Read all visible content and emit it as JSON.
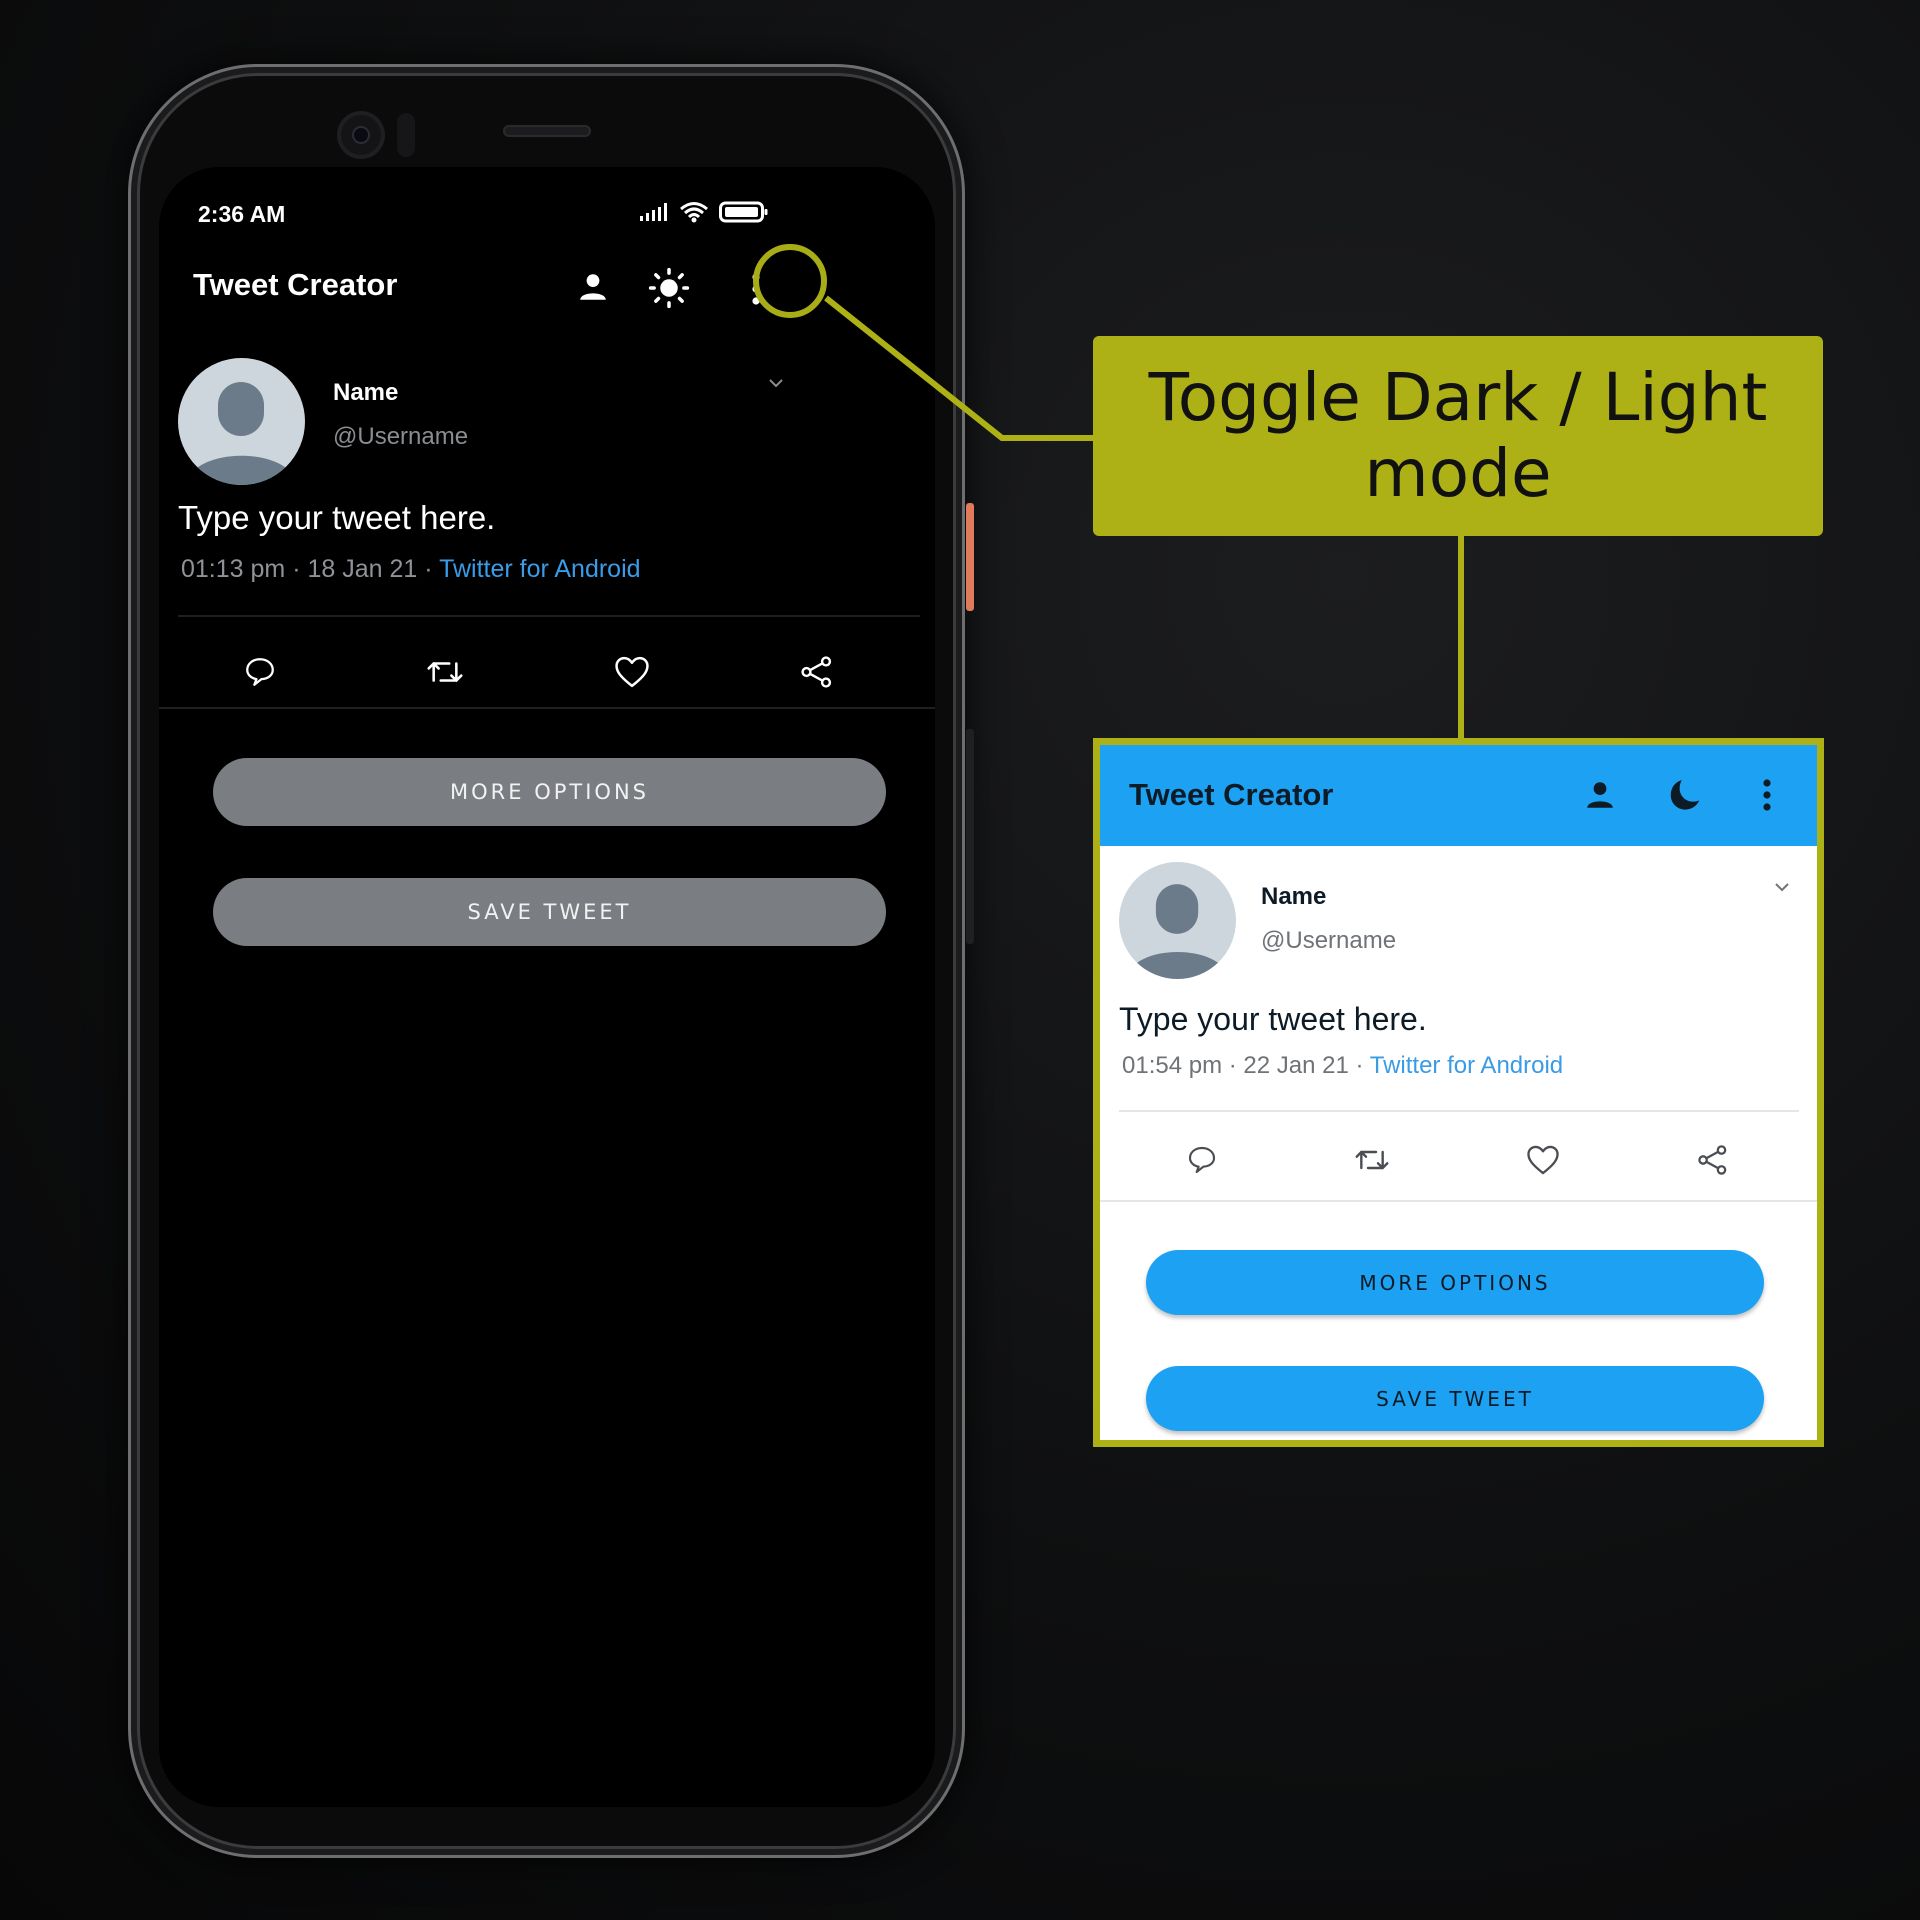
{
  "dark_screen": {
    "status_time": "2:36 AM",
    "app_title": "Tweet Creator",
    "name": "Name",
    "username": "@Username",
    "tweet_text": "Type your tweet here.",
    "time": "01:13 pm",
    "date": "18 Jan 21",
    "source": "Twitter for Android",
    "more_options": "MORE OPTIONS",
    "save_tweet": "SAVE TWEET",
    "theme_icon": "sun-icon"
  },
  "callout": {
    "text": "Toggle Dark / Light mode"
  },
  "light_preview": {
    "app_title": "Tweet Creator",
    "name": "Name",
    "username": "@Username",
    "tweet_text": "Type your tweet here.",
    "time": "01:54 pm",
    "date": "22 Jan 21",
    "source": "Twitter for Android",
    "more_options": "MORE OPTIONS",
    "save_tweet": "SAVE TWEET",
    "theme_icon": "moon-icon"
  },
  "colors": {
    "accent_callout": "#adb115",
    "twitter_blue": "#1da1f2",
    "link_blue": "#3a9be6",
    "dark_button": "#7a7d82"
  },
  "separator": " · "
}
